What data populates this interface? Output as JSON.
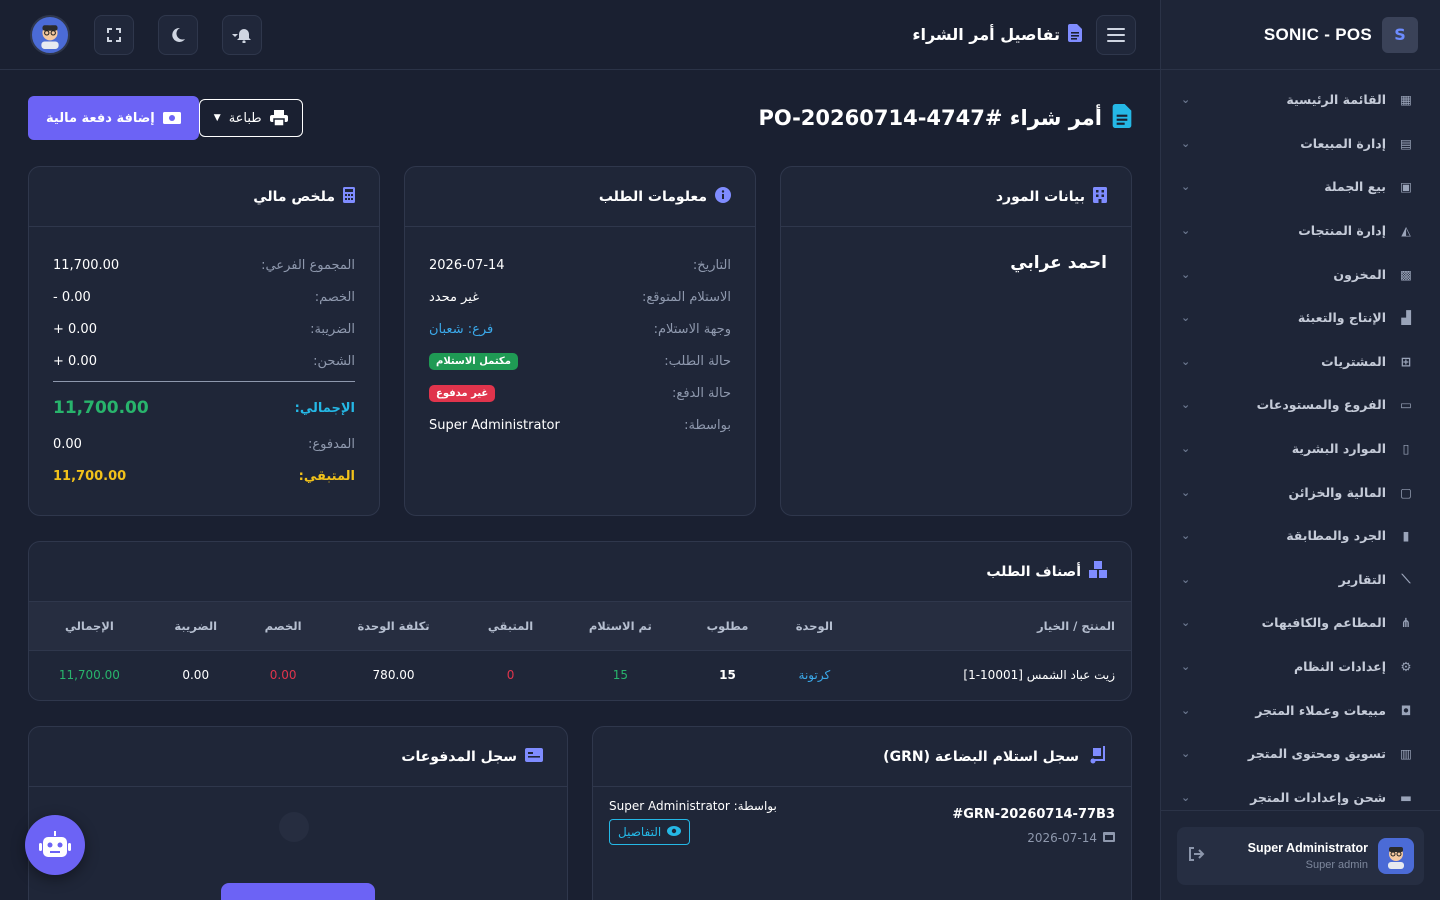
{
  "brand": {
    "name": "SONIC - POS"
  },
  "sidebar": {
    "items": [
      {
        "label": "القائمة الرئيسية",
        "icon": "grid-icon"
      },
      {
        "label": "إدارة المبيعات",
        "icon": "cash-register-icon"
      },
      {
        "label": "بيع الجملة",
        "icon": "boxes-icon"
      },
      {
        "label": "إدارة المنتجات",
        "icon": "shirt-icon"
      },
      {
        "label": "المخزون",
        "icon": "cubes-icon"
      },
      {
        "label": "الإنتاج والتعبئة",
        "icon": "factory-icon"
      },
      {
        "label": "المشتريات",
        "icon": "cart-icon"
      },
      {
        "label": "الفروع والمستودعات",
        "icon": "store-icon"
      },
      {
        "label": "الموارد البشرية",
        "icon": "id-badge-icon"
      },
      {
        "label": "المالية والخزائن",
        "icon": "money-icon"
      },
      {
        "label": "الجرد والمطابقة",
        "icon": "clipboard-check-icon"
      },
      {
        "label": "التقارير",
        "icon": "chart-line-icon"
      },
      {
        "label": "المطاعم والكافيهات",
        "icon": "utensils-icon"
      },
      {
        "label": "إعدادات النظام",
        "icon": "gear-icon"
      },
      {
        "label": "مبيعات وعملاء المتجر",
        "icon": "shopping-bag-icon"
      },
      {
        "label": "تسويق ومحتوى المتجر",
        "icon": "gift-icon"
      },
      {
        "label": "شحن وإعدادات المتجر",
        "icon": "truck-icon"
      }
    ],
    "user": {
      "name": "Super Administrator",
      "role": "Super admin"
    }
  },
  "topbar": {
    "title": "تفاصيل أمر الشراء"
  },
  "page": {
    "title": "أمر شراء #PO-20260714-4747",
    "print_label": "طباعة",
    "add_payment_label": "إضافة دفعة مالية"
  },
  "supplier_card": {
    "title": "بيانات المورد",
    "name": "احمد عرابي"
  },
  "order_info": {
    "title": "معلومات الطلب",
    "date_label": "التاريخ:",
    "date": "2026-07-14",
    "expected_label": "الاستلام المتوقع:",
    "expected": "غير محدد",
    "destination_label": "وجهة الاستلام:",
    "destination": "فرع: شعبان",
    "status_label": "حالة الطلب:",
    "status": "مكتمل الاستلام",
    "payment_label": "حالة الدفع:",
    "payment": "غير مدفوع",
    "by_label": "بواسطة:",
    "by": "Super Administrator"
  },
  "financial": {
    "title": "ملخص مالي",
    "subtotal_label": "المجموع الفرعي:",
    "subtotal": "11,700.00",
    "discount_label": "الخصم:",
    "discount": "- 0.00",
    "tax_label": "الضريبة:",
    "tax": "+ 0.00",
    "shipping_label": "الشحن:",
    "shipping": "+ 0.00",
    "total_label": "الإجمالي:",
    "total": "11,700.00",
    "paid_label": "المدفوع:",
    "paid": "0.00",
    "remaining_label": "المتبقي:",
    "remaining": "11,700.00"
  },
  "items": {
    "title": "أصناف الطلب",
    "columns": [
      "المنتج / الخيار",
      "الوحدة",
      "مطلوب",
      "تم الاستلام",
      "المتبقي",
      "تكلفة الوحدة",
      "الخصم",
      "الضريبة",
      "الإجمالي"
    ],
    "rows": [
      {
        "product": "زيت عباد الشمس [10001-1]",
        "unit": "كرتونة",
        "ordered": "15",
        "received": "15",
        "remaining": "0",
        "unit_cost": "780.00",
        "discount": "0.00",
        "tax": "0.00",
        "total": "11,700.00"
      }
    ]
  },
  "grn": {
    "title": "سجل استلام البضاعة (GRN)",
    "number": "#GRN-20260714-77B3",
    "date": "2026-07-14",
    "by": "بواسطة: Super Administrator",
    "details_label": "التفاصيل"
  },
  "payments": {
    "title": "سجل المدفوعات"
  }
}
